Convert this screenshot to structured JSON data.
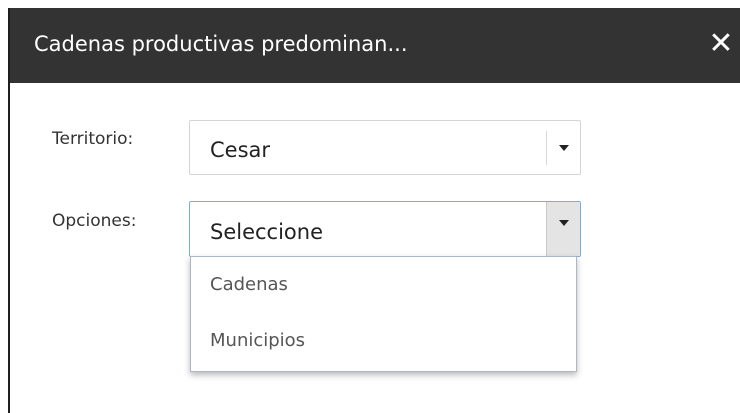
{
  "dialog": {
    "title": "Cadenas productivas predominan...",
    "close_icon": "close-icon",
    "close_glyph": "✕"
  },
  "form": {
    "territorio": {
      "label": "Territorio:",
      "value": "Cesar"
    },
    "opciones": {
      "label": "Opciones:",
      "value": "Seleccione",
      "options": [
        "Cadenas",
        "Municipios"
      ]
    }
  },
  "colors": {
    "titlebar_bg": "#333333",
    "focus_border": "#79aee3"
  }
}
